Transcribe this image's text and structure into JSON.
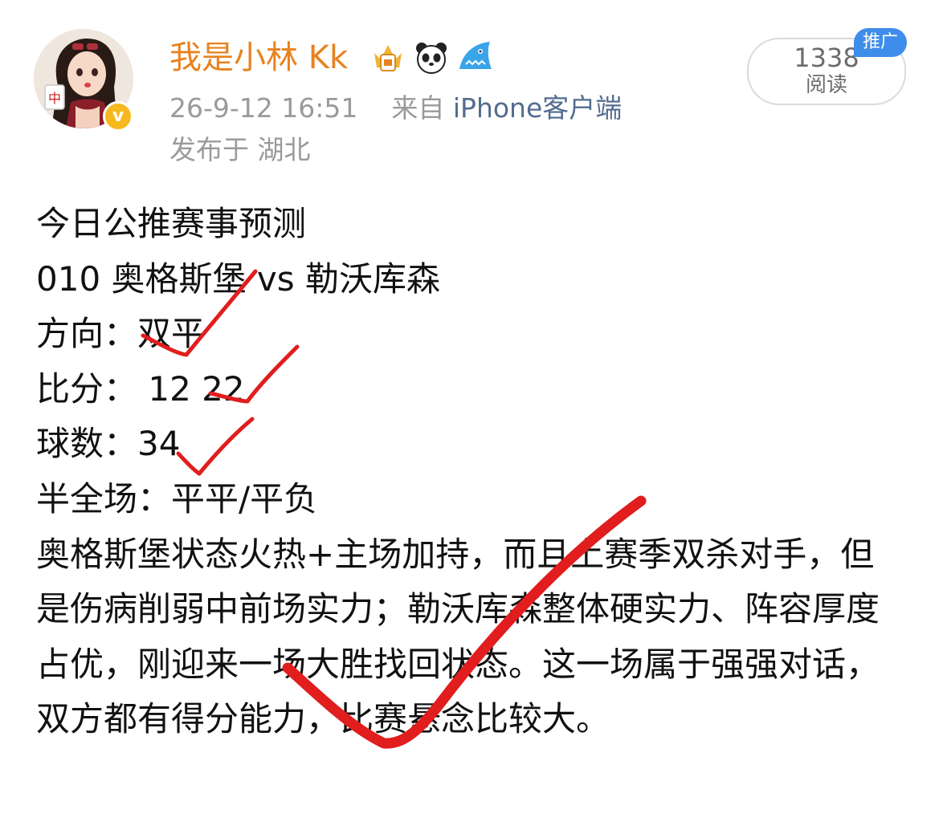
{
  "post": {
    "author": {
      "name": "我是小林 Kk",
      "verified": true,
      "badges": [
        "crown-mahjong-icon",
        "panda-icon",
        "shark-icon"
      ]
    },
    "timestamp": "26-9-12 16:51",
    "source_prefix": "来自",
    "source": "iPhone客户端",
    "location": "发布于 湖北",
    "read_count": "1338",
    "read_label": "阅读",
    "promo_tag": "推广",
    "lines": [
      "今日公推赛事预测",
      "010 奥格斯堡 vs 勒沃库森",
      "方向：双平",
      "比分：  12  22",
      "球数：34",
      "半全场：平平/平负"
    ],
    "paragraph": "奥格斯堡状态火热+主场加持，而且上赛季双杀对手，但是伤病削弱中前场实力；勒沃库森整体硬实力、阵容厚度占优，刚迎来一场大胜找回状态。这一场属于强强对话，双方都有得分能力，比赛悬念比较大。"
  },
  "colors": {
    "author_name": "#e8821f",
    "meta": "#9a9a9a",
    "source_link": "#536c90",
    "promo_tag_bg": "#3e8dea",
    "verified_badge": "#f6b91e",
    "check_mark": "#e11d1d"
  }
}
